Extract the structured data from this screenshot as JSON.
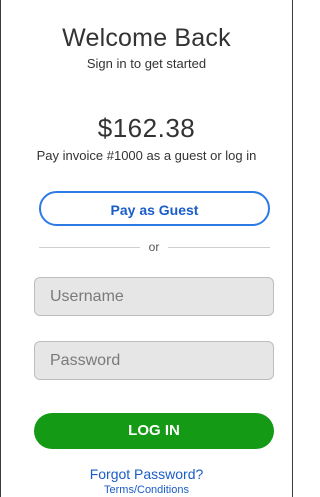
{
  "header": {
    "title": "Welcome Back",
    "subtitle": "Sign in to get started"
  },
  "invoice": {
    "amount": "$162.38",
    "note": "Pay invoice #1000 as a guest or log in"
  },
  "guest": {
    "button_label": "Pay as Guest"
  },
  "divider": {
    "label": "or"
  },
  "login_form": {
    "username_placeholder": "Username",
    "password_placeholder": "Password",
    "login_label": "LOG IN"
  },
  "links": {
    "forgot_password": "Forgot Password?",
    "terms": "Terms/Conditions"
  },
  "colors": {
    "accent_blue": "#2c7be5",
    "link_blue": "#1a5cc8",
    "login_green": "#149a14",
    "field_bg": "#e6e6e6"
  }
}
